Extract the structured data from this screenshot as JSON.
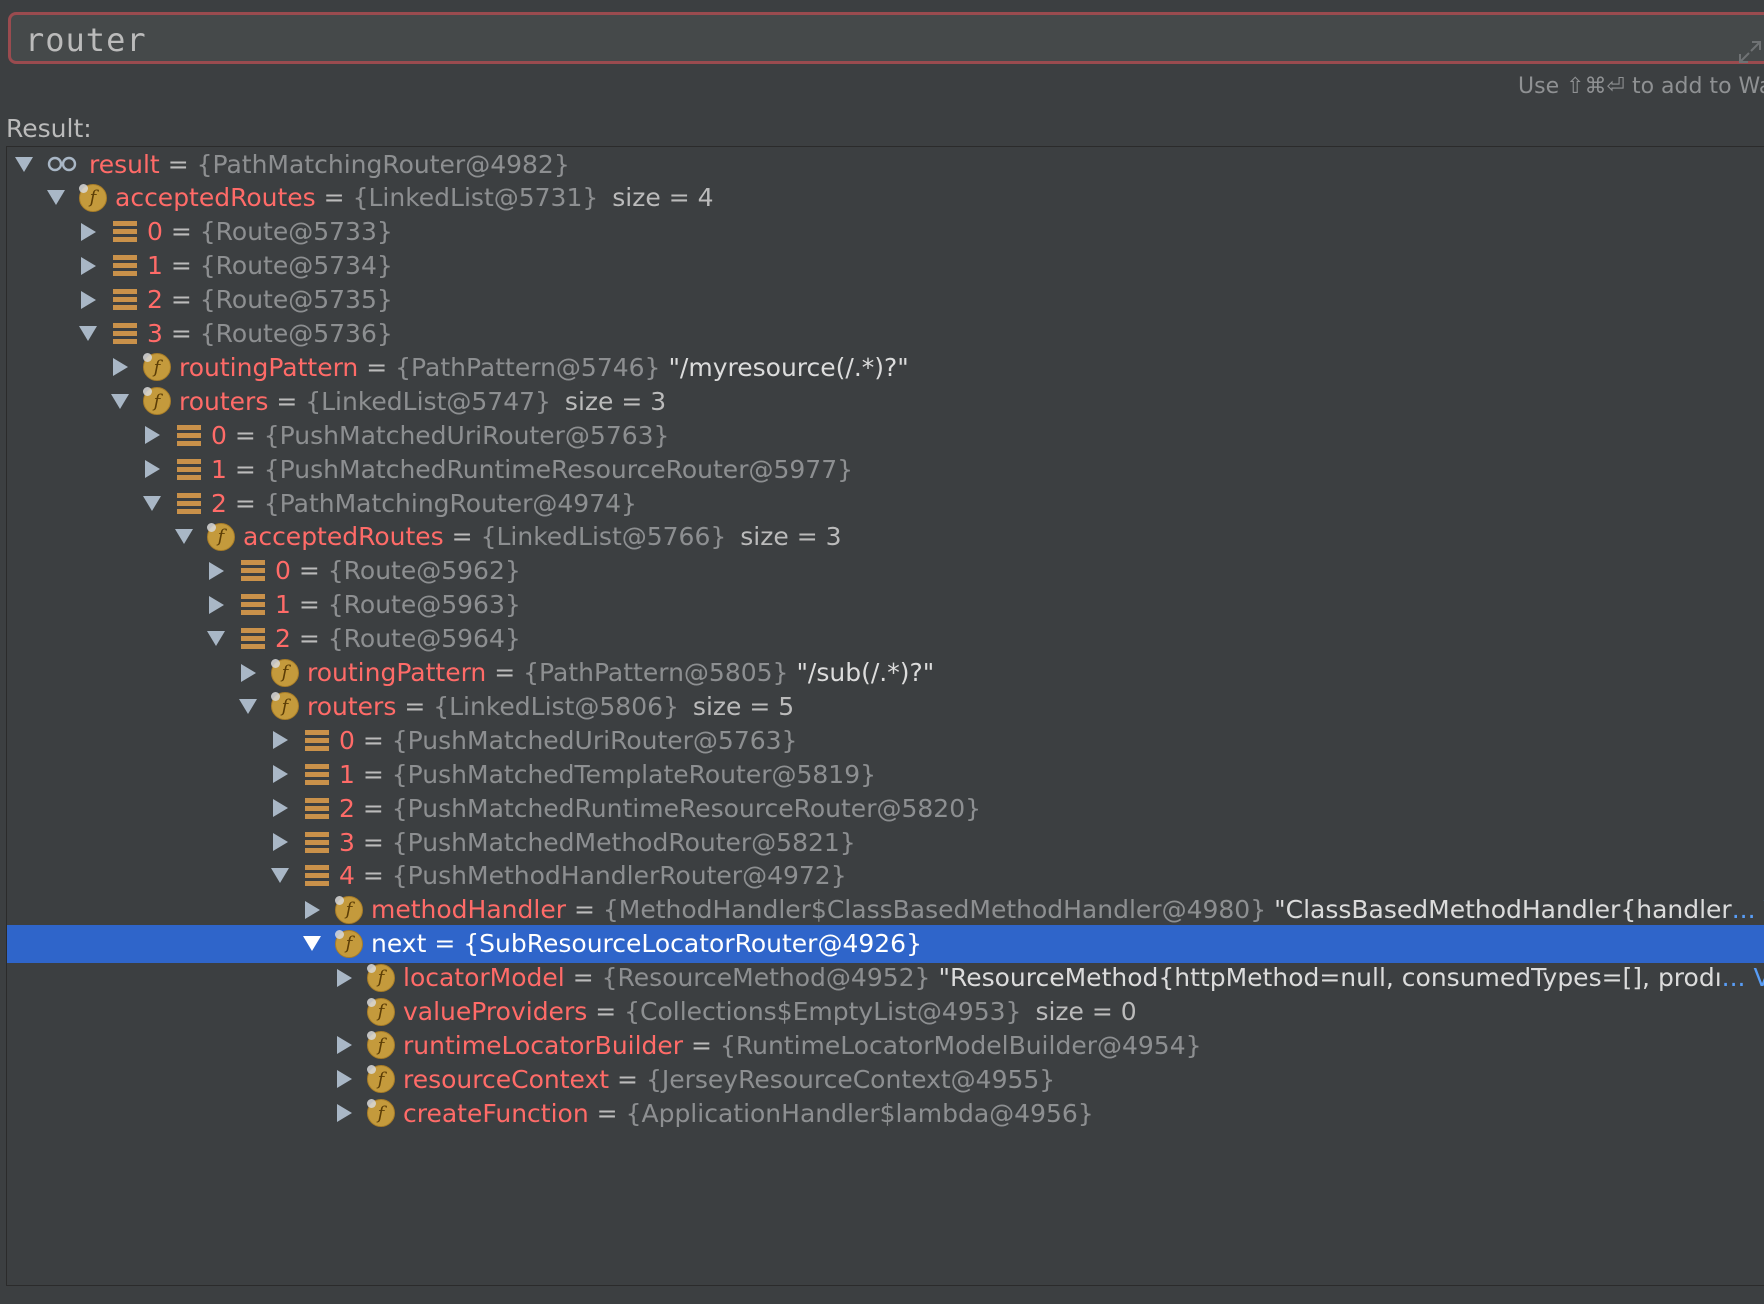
{
  "expression": {
    "text": "router"
  },
  "hint": "Use ⇧⌘⏎ to add to Wa",
  "result_label": "Result:",
  "tree": [
    {
      "depth": 0,
      "toggle": "down",
      "icon": "watch",
      "name": "result",
      "eq": "=",
      "type": "{PathMatchingRouter@4982}",
      "extra": "",
      "ellipsis": ""
    },
    {
      "depth": 1,
      "toggle": "down",
      "icon": "field",
      "name": "acceptedRoutes",
      "eq": "=",
      "type": "{LinkedList@5731}",
      "extra": "size = 4",
      "ellipsis": ""
    },
    {
      "depth": 2,
      "toggle": "right",
      "icon": "array",
      "name": "0",
      "eq": "=",
      "type": "{Route@5733}",
      "extra": "",
      "ellipsis": ""
    },
    {
      "depth": 2,
      "toggle": "right",
      "icon": "array",
      "name": "1",
      "eq": "=",
      "type": "{Route@5734}",
      "extra": "",
      "ellipsis": ""
    },
    {
      "depth": 2,
      "toggle": "right",
      "icon": "array",
      "name": "2",
      "eq": "=",
      "type": "{Route@5735}",
      "extra": "",
      "ellipsis": ""
    },
    {
      "depth": 2,
      "toggle": "down",
      "icon": "array",
      "name": "3",
      "eq": "=",
      "type": "{Route@5736}",
      "extra": "",
      "ellipsis": ""
    },
    {
      "depth": 3,
      "toggle": "right",
      "icon": "field",
      "name": "routingPattern",
      "eq": "=",
      "type": "{PathPattern@5746}",
      "extra": "\"/myresource(/.*)?\"",
      "ellipsis": ""
    },
    {
      "depth": 3,
      "toggle": "down",
      "icon": "field",
      "name": "routers",
      "eq": "=",
      "type": "{LinkedList@5747}",
      "extra": "size = 3",
      "ellipsis": ""
    },
    {
      "depth": 4,
      "toggle": "right",
      "icon": "array",
      "name": "0",
      "eq": "=",
      "type": "{PushMatchedUriRouter@5763}",
      "extra": "",
      "ellipsis": ""
    },
    {
      "depth": 4,
      "toggle": "right",
      "icon": "array",
      "name": "1",
      "eq": "=",
      "type": "{PushMatchedRuntimeResourceRouter@5977}",
      "extra": "",
      "ellipsis": ""
    },
    {
      "depth": 4,
      "toggle": "down",
      "icon": "array",
      "name": "2",
      "eq": "=",
      "type": "{PathMatchingRouter@4974}",
      "extra": "",
      "ellipsis": ""
    },
    {
      "depth": 5,
      "toggle": "down",
      "icon": "field",
      "name": "acceptedRoutes",
      "eq": "=",
      "type": "{LinkedList@5766}",
      "extra": "size = 3",
      "ellipsis": ""
    },
    {
      "depth": 6,
      "toggle": "right",
      "icon": "array",
      "name": "0",
      "eq": "=",
      "type": "{Route@5962}",
      "extra": "",
      "ellipsis": ""
    },
    {
      "depth": 6,
      "toggle": "right",
      "icon": "array",
      "name": "1",
      "eq": "=",
      "type": "{Route@5963}",
      "extra": "",
      "ellipsis": ""
    },
    {
      "depth": 6,
      "toggle": "down",
      "icon": "array",
      "name": "2",
      "eq": "=",
      "type": "{Route@5964}",
      "extra": "",
      "ellipsis": ""
    },
    {
      "depth": 7,
      "toggle": "right",
      "icon": "field",
      "name": "routingPattern",
      "eq": "=",
      "type": "{PathPattern@5805}",
      "extra": "\"/sub(/.*)?\"",
      "ellipsis": ""
    },
    {
      "depth": 7,
      "toggle": "down",
      "icon": "field",
      "name": "routers",
      "eq": "=",
      "type": "{LinkedList@5806}",
      "extra": "size = 5",
      "ellipsis": ""
    },
    {
      "depth": 8,
      "toggle": "right",
      "icon": "array",
      "name": "0",
      "eq": "=",
      "type": "{PushMatchedUriRouter@5763}",
      "extra": "",
      "ellipsis": ""
    },
    {
      "depth": 8,
      "toggle": "right",
      "icon": "array",
      "name": "1",
      "eq": "=",
      "type": "{PushMatchedTemplateRouter@5819}",
      "extra": "",
      "ellipsis": ""
    },
    {
      "depth": 8,
      "toggle": "right",
      "icon": "array",
      "name": "2",
      "eq": "=",
      "type": "{PushMatchedRuntimeResourceRouter@5820}",
      "extra": "",
      "ellipsis": ""
    },
    {
      "depth": 8,
      "toggle": "right",
      "icon": "array",
      "name": "3",
      "eq": "=",
      "type": "{PushMatchedMethodRouter@5821}",
      "extra": "",
      "ellipsis": ""
    },
    {
      "depth": 8,
      "toggle": "down",
      "icon": "array",
      "name": "4",
      "eq": "=",
      "type": "{PushMethodHandlerRouter@4972}",
      "extra": "",
      "ellipsis": ""
    },
    {
      "depth": 9,
      "toggle": "right",
      "icon": "field",
      "name": "methodHandler",
      "eq": "=",
      "type": "{MethodHandler$ClassBasedMethodHandler@4980}",
      "extra": "\"ClassBasedMethodHandler{handler",
      "ellipsis": "... V"
    },
    {
      "depth": 9,
      "toggle": "down",
      "icon": "field",
      "name": "next",
      "eq": "=",
      "type": "{SubResourceLocatorRouter@4926}",
      "extra": "",
      "ellipsis": "",
      "selected": true
    },
    {
      "depth": 10,
      "toggle": "right",
      "icon": "field",
      "name": "locatorModel",
      "eq": "=",
      "type": "{ResourceMethod@4952}",
      "extra": "\"ResourceMethod{httpMethod=null, consumedTypes=[], prodı",
      "ellipsis": "... V"
    },
    {
      "depth": 10,
      "toggle": "none",
      "icon": "field",
      "name": "valueProviders",
      "eq": "=",
      "type": "{Collections$EmptyList@4953}",
      "extra": "size = 0",
      "ellipsis": ""
    },
    {
      "depth": 10,
      "toggle": "right",
      "icon": "field",
      "name": "runtimeLocatorBuilder",
      "eq": "=",
      "type": "{RuntimeLocatorModelBuilder@4954}",
      "extra": "",
      "ellipsis": ""
    },
    {
      "depth": 10,
      "toggle": "right",
      "icon": "field",
      "name": "resourceContext",
      "eq": "=",
      "type": "{JerseyResourceContext@4955}",
      "extra": "",
      "ellipsis": ""
    },
    {
      "depth": 10,
      "toggle": "right",
      "icon": "field",
      "name": "createFunction",
      "eq": "=",
      "type": "{ApplicationHandler$lambda@4956}",
      "extra": "",
      "ellipsis": ""
    }
  ]
}
